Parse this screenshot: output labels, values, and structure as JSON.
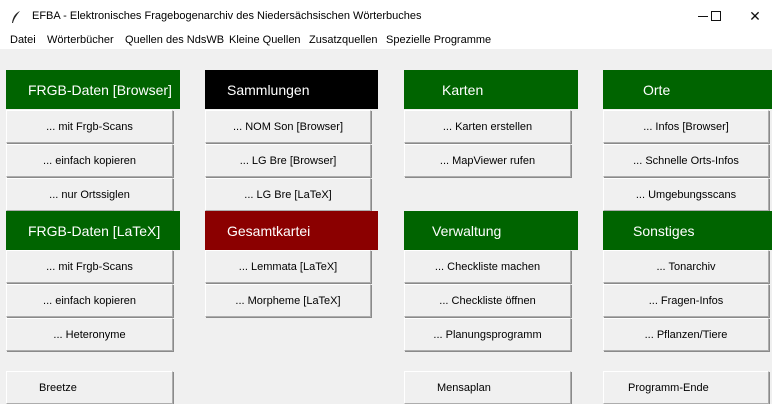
{
  "window": {
    "title": "EFBA - Elektronisches Fragebogenarchiv des Niedersächsischen Wörterbuches",
    "icon": "feather-icon",
    "minimize_glyph": "—",
    "maximize_glyph": "☐",
    "close_glyph": "✕"
  },
  "menu": [
    "Datei",
    "Wörterbücher",
    "Quellen des NdsWB",
    "Kleine Quellen",
    "Zusatzquellen",
    "Spezielle Programme"
  ],
  "colors": {
    "green": "#006400",
    "black": "#000000",
    "darkred": "#8b0000"
  },
  "panels": {
    "frgb_browser": {
      "header": "FRGB-Daten [Browser]",
      "buttons": [
        "... mit Frgb-Scans",
        "... einfach kopieren",
        "... nur Ortssiglen"
      ]
    },
    "sammlungen": {
      "header": "Sammlungen",
      "buttons": [
        "... NOM Son [Browser]",
        "... LG Bre  [Browser]",
        "... LG Bre  [LaTeX]"
      ]
    },
    "karten": {
      "header": "Karten",
      "buttons": [
        "... Karten erstellen",
        "... MapViewer rufen"
      ]
    },
    "orte": {
      "header": "Orte",
      "buttons": [
        "... Infos [Browser]",
        "... Schnelle Orts-Infos",
        "... Umgebungsscans"
      ]
    },
    "frgb_latex": {
      "header": "FRGB-Daten  [LaTeX]",
      "buttons": [
        "... mit Frgb-Scans",
        "... einfach kopieren",
        "... Heteronyme"
      ]
    },
    "gesamtkartei": {
      "header": "Gesamtkartei",
      "buttons": [
        "... Lemmata  [LaTeX]",
        "... Morpheme [LaTeX]"
      ]
    },
    "verwaltung": {
      "header": "Verwaltung",
      "buttons": [
        "... Checkliste machen",
        "... Checkliste öffnen",
        "... Planungsprogramm"
      ]
    },
    "sonstiges": {
      "header": "Sonstiges",
      "buttons": [
        "... Tonarchiv",
        "... Fragen-Infos",
        "... Pflanzen/Tiere"
      ]
    }
  },
  "bottom": {
    "breetze": "Breetze",
    "mensaplan": "Mensaplan",
    "programm_ende": "Programm-Ende"
  }
}
